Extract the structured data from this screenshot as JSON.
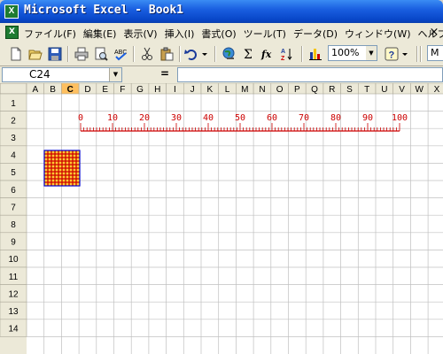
{
  "window": {
    "title": "Microsoft Excel - Book1",
    "app_icon": "excel-icon",
    "icon_letter": "X"
  },
  "menu": {
    "items": [
      "ファイル(F)",
      "編集(E)",
      "表示(V)",
      "挿入(I)",
      "書式(O)",
      "ツール(T)",
      "データ(D)",
      "ウィンドウ(W)",
      "ヘルプ(H)"
    ],
    "close_glyph": "×"
  },
  "toolbar": {
    "zoom": "100%",
    "font_partial": "M",
    "icons": [
      "new-icon",
      "open-icon",
      "save-icon",
      "print-icon",
      "print-preview-icon",
      "spellcheck-icon",
      "cut-icon",
      "paste-icon",
      "undo-icon",
      "hyperlink-icon",
      "autosum-icon",
      "function-icon",
      "sort-icon",
      "chart-icon",
      "help-icon"
    ]
  },
  "formula_bar": {
    "name_box": "C24",
    "equals": "=",
    "formula": ""
  },
  "sheet": {
    "columns": [
      "A",
      "B",
      "C",
      "D",
      "E",
      "F",
      "G",
      "H",
      "I",
      "J",
      "K",
      "L",
      "M",
      "N",
      "O",
      "P",
      "Q",
      "R",
      "S",
      "T",
      "U",
      "V",
      "W",
      "X"
    ],
    "active_column": "C",
    "rows": [
      "1",
      "2",
      "3",
      "4",
      "5",
      "6",
      "7",
      "8",
      "9",
      "10",
      "11",
      "12",
      "13",
      "14"
    ],
    "ruler": {
      "labels": [
        "0",
        "10",
        "20",
        "30",
        "40",
        "50",
        "60",
        "70",
        "80",
        "90",
        "100"
      ],
      "color": "#cc0000"
    },
    "pattern_color_grid": "#cc0000",
    "pattern_color_border": "#0000cc",
    "pattern_fill": "#ffcc33"
  }
}
